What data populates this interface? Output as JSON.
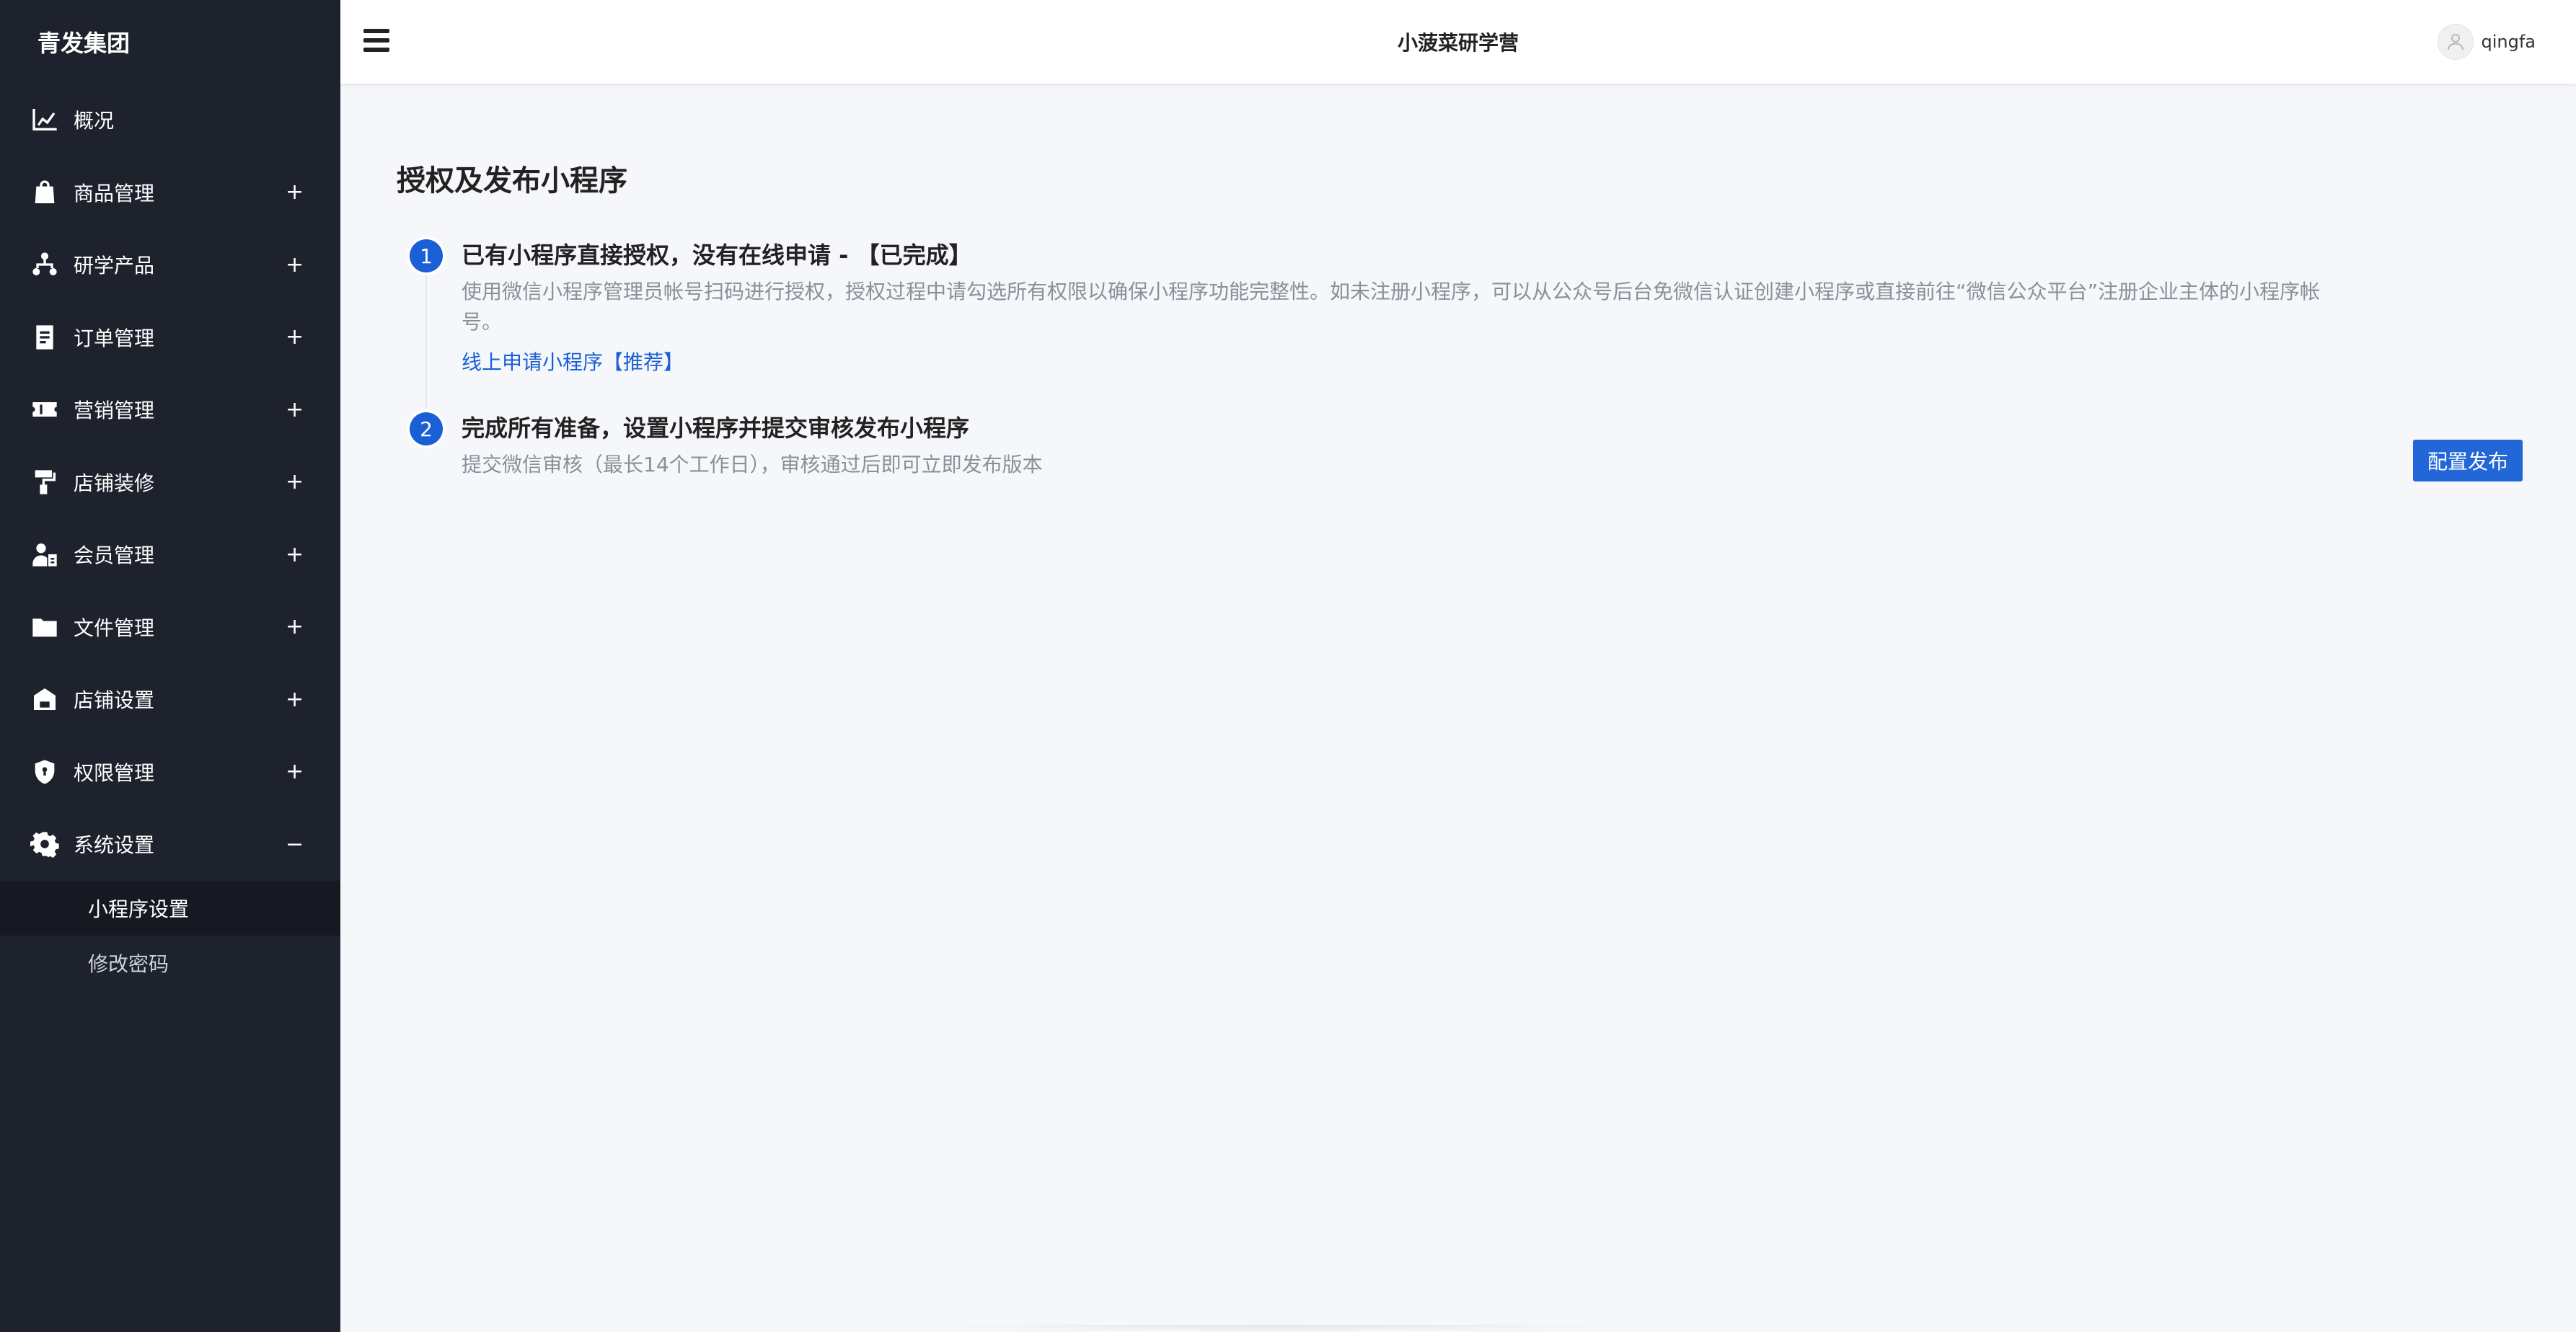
{
  "sidebar": {
    "brand": "青发集团",
    "items": [
      {
        "label": "概况",
        "toggle": ""
      },
      {
        "label": "商品管理",
        "toggle": "+"
      },
      {
        "label": "研学产品",
        "toggle": "+"
      },
      {
        "label": "订单管理",
        "toggle": "+"
      },
      {
        "label": "营销管理",
        "toggle": "+"
      },
      {
        "label": "店铺装修",
        "toggle": "+"
      },
      {
        "label": "会员管理",
        "toggle": "+"
      },
      {
        "label": "文件管理",
        "toggle": "+"
      },
      {
        "label": "店铺设置",
        "toggle": "+"
      },
      {
        "label": "权限管理",
        "toggle": "+"
      },
      {
        "label": "系统设置",
        "toggle": "−"
      }
    ],
    "submenu": [
      {
        "label": "小程序设置"
      },
      {
        "label": "修改密码"
      }
    ]
  },
  "header": {
    "title": "小菠菜研学营",
    "username": "qingfa"
  },
  "main": {
    "title": "授权及发布小程序",
    "steps": [
      {
        "number": "1",
        "title": "已有小程序直接授权，没有在线申请 - 【已完成】",
        "desc": "使用微信小程序管理员帐号扫码进行授权，授权过程中请勾选所有权限以确保小程序功能完整性。如未注册小程序，可以从公众号后台免微信认证创建小程序或直接前往“微信公众平台”注册企业主体的小程序帐号。",
        "link": "线上申请小程序【推荐】"
      },
      {
        "number": "2",
        "title": "完成所有准备，设置小程序并提交审核发布小程序",
        "desc": "提交微信审核（最长14个工作日），审核通过后即可立即发布版本"
      }
    ],
    "publish_button": "配置发布"
  },
  "colors": {
    "sidebar_bg": "#1e222d",
    "sidebar_active_bg": "#161922",
    "accent": "#1a5fd6",
    "button_bg": "#2266d8",
    "page_bg": "#f5f7fa"
  },
  "icons": [
    "chart-line-icon",
    "shopping-bag-icon",
    "sitemap-icon",
    "document-icon",
    "ticket-icon",
    "paint-roller-icon",
    "user-card-icon",
    "folder-icon",
    "store-icon",
    "shield-icon",
    "gear-icon",
    "hamburger-icon",
    "user-avatar-icon"
  ]
}
